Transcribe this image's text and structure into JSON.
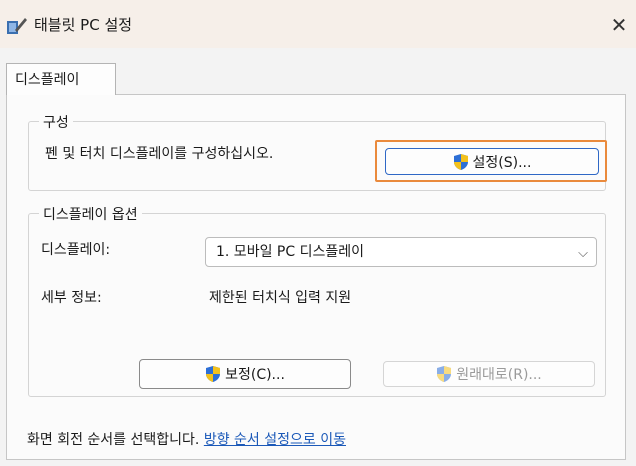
{
  "window": {
    "title": "태블릿 PC 설정",
    "close_glyph": "✕"
  },
  "tabs": [
    {
      "label": "디스플레이"
    }
  ],
  "configure": {
    "title": "구성",
    "description": "펜 및 터치 디스플레이를 구성하십시오.",
    "setup_button": "설정(S)..."
  },
  "display_options": {
    "title": "디스플레이 옵션",
    "display_label": "디스플레이:",
    "display_value": "1. 모바일 PC 디스플레이",
    "details_label": "세부 정보:",
    "details_value": "제한된 터치식 입력 지원",
    "calibrate_button": "보정(C)...",
    "reset_button": "원래대로(R)..."
  },
  "footer": {
    "text": "화면 회전 순서를 선택합니다.",
    "link": "방향 순서 설정으로 이동"
  },
  "colors": {
    "focus": "#ea8a3c",
    "link": "#1a58b8",
    "shield_blue": "#2d6fd6",
    "shield_yellow": "#f3c11c"
  }
}
